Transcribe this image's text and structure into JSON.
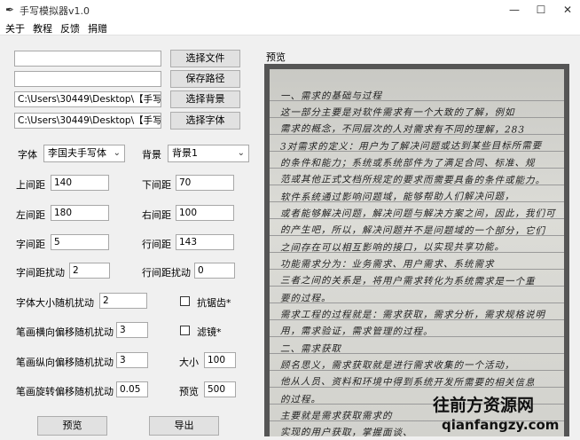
{
  "window": {
    "title": "手写模拟器v1.0",
    "minimize": "—",
    "maximize": "☐",
    "close": "✕"
  },
  "menu": [
    "关于",
    "教程",
    "反馈",
    "捐赠"
  ],
  "paths": {
    "row1": {
      "value": "",
      "button": "选择文件"
    },
    "row2": {
      "value": "",
      "button": "保存路径"
    },
    "row3": {
      "value": "C:\\Users\\30449\\Desktop\\【手写模",
      "button": "选择背景"
    },
    "row4": {
      "value": "C:\\Users\\30449\\Desktop\\【手写模",
      "button": "选择字体"
    }
  },
  "font": {
    "label": "字体",
    "value": "李国夫手写体"
  },
  "background": {
    "label": "背景",
    "value": "背景1"
  },
  "fields": {
    "top_margin": {
      "label": "上间距",
      "value": "140"
    },
    "bottom_margin": {
      "label": "下间距",
      "value": "70"
    },
    "left_margin": {
      "label": "左间距",
      "value": "180"
    },
    "right_margin": {
      "label": "右间距",
      "value": "100"
    },
    "char_spacing": {
      "label": "字间距",
      "value": "5"
    },
    "line_spacing": {
      "label": "行间距",
      "value": "143"
    },
    "char_spacing_jitter": {
      "label": "字间距扰动",
      "value": "2"
    },
    "line_spacing_jitter": {
      "label": "行间距扰动",
      "value": "0"
    },
    "font_size_jitter": {
      "label": "字体大小随机扰动",
      "value": "2"
    },
    "stroke_h_jitter": {
      "label": "笔画横向偏移随机扰动",
      "value": "3"
    },
    "stroke_v_jitter": {
      "label": "笔画纵向偏移随机扰动",
      "value": "3"
    },
    "stroke_rot_jitter": {
      "label": "笔画旋转偏移随机扰动",
      "value": "0.05"
    },
    "size": {
      "label": "大小",
      "value": "100"
    },
    "preview_size": {
      "label": "预览",
      "value": "500"
    }
  },
  "checkboxes": {
    "antialias": "抗锯齿*",
    "filter": "滤镜*"
  },
  "buttons": {
    "preview": "预览",
    "export": "导出"
  },
  "preview_label": "预览",
  "preview_lines": [
    "一、需求的基础与过程",
    "这一部分主要是对软件需求有一个大致的了解，例如",
    "需求的概念，不同层次的人对需求有不同的理解，283",
    "3对需求的定义：用户为了解决问题或达到某些目标所需要",
    "的条件和能力；系统或系统部件为了满足合同、标准、规",
    "范或其他正式文档所规定的要求而需要具备的条件或能力。",
    "软件系统通过影响问题域，能够帮助人们解决问题，",
    "或者能够解决问题，解决问题与解决方案之间，因此，我们可以",
    "的产生吧，所以，解决问题并不是问题域的一个部分，它们",
    "之间存在可以相互影响的接口，以实现共享功能。",
    "功能需求分为：业务需求、用户需求、系统需求",
    "三者之间的关系是，将用户需求转化为系统需求是一个重",
    "要的过程。",
    "需求工程的过程就是：需求获取，需求分析，需求规格说明",
    "用，需求验证，需求管理的过程。",
    "二、需求获取",
    "顾名思义，需求获取就是进行需求收集的一个活动，",
    "他从人员、资料和环境中得到系统开发所需要的相关信息",
    "的过程。",
    "主要就是需求获取需求的",
    "实现的用户获取，掌握面谈、"
  ],
  "watermark": {
    "text": "往前方资源网",
    "url": "qianfangzy.com"
  }
}
